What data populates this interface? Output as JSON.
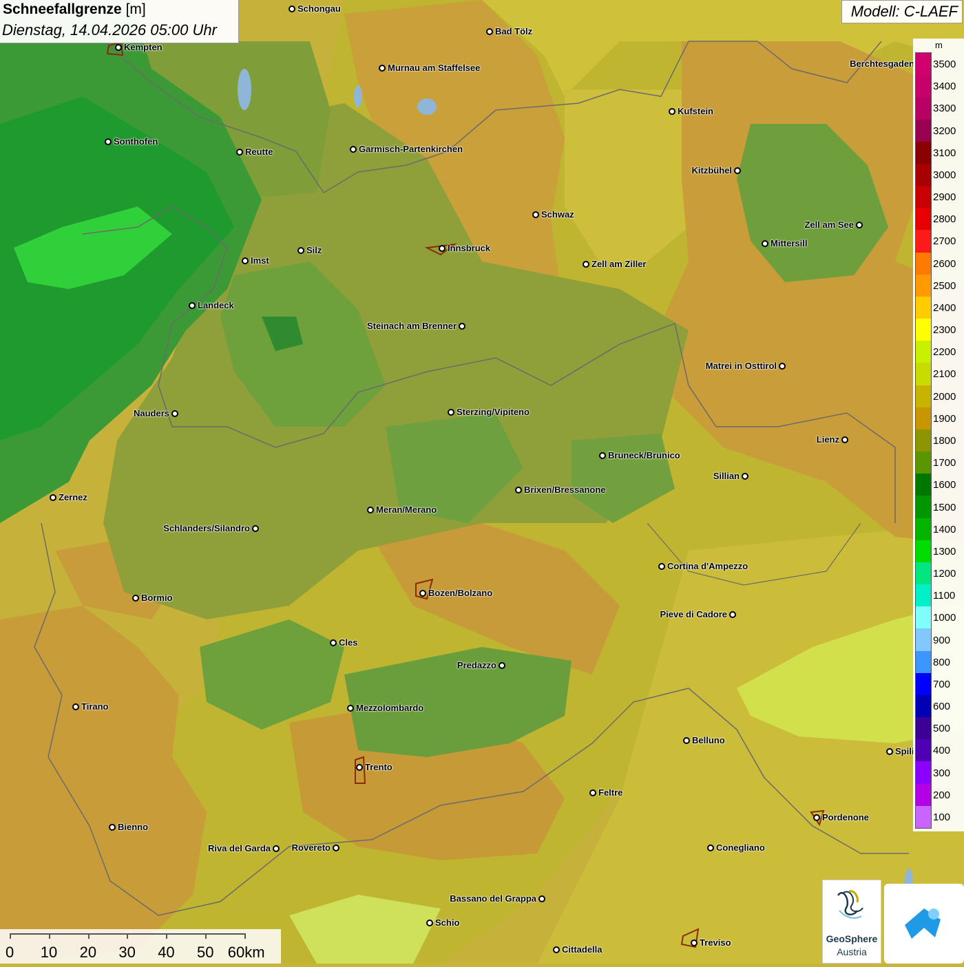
{
  "title": {
    "name": "Schneefallgrenze",
    "unit": "[m]",
    "datetime": "Dienstag, 14.04.2026 05:00 Uhr"
  },
  "model": "Modell: C-LAEF",
  "legend": {
    "unit": "m",
    "levels": [
      {
        "label": "3500",
        "color": "#d0006e"
      },
      {
        "label": "3400",
        "color": "#c8006a"
      },
      {
        "label": "3300",
        "color": "#b80064"
      },
      {
        "label": "3200",
        "color": "#9a0050"
      },
      {
        "label": "3100",
        "color": "#8a0000"
      },
      {
        "label": "3000",
        "color": "#a80000"
      },
      {
        "label": "2900",
        "color": "#c80000"
      },
      {
        "label": "2800",
        "color": "#e80000"
      },
      {
        "label": "2700",
        "color": "#ff1a1a"
      },
      {
        "label": "2600",
        "color": "#ff7a00"
      },
      {
        "label": "2500",
        "color": "#ff9a00"
      },
      {
        "label": "2400",
        "color": "#ffcc00"
      },
      {
        "label": "2300",
        "color": "#ffff00"
      },
      {
        "label": "2200",
        "color": "#c8f000"
      },
      {
        "label": "2100",
        "color": "#c8dc00"
      },
      {
        "label": "2000",
        "color": "#c8b400"
      },
      {
        "label": "1900",
        "color": "#c89600"
      },
      {
        "label": "1800",
        "color": "#8c9600"
      },
      {
        "label": "1700",
        "color": "#5a9600"
      },
      {
        "label": "1600",
        "color": "#007800"
      },
      {
        "label": "1500",
        "color": "#009600"
      },
      {
        "label": "1400",
        "color": "#00b400"
      },
      {
        "label": "1300",
        "color": "#00dc00"
      },
      {
        "label": "1200",
        "color": "#00e680"
      },
      {
        "label": "1100",
        "color": "#00f0c8"
      },
      {
        "label": "1000",
        "color": "#80ffff"
      },
      {
        "label": "900",
        "color": "#80c8ff"
      },
      {
        "label": "800",
        "color": "#3c96ff"
      },
      {
        "label": "700",
        "color": "#0000ff"
      },
      {
        "label": "600",
        "color": "#0000b4"
      },
      {
        "label": "500",
        "color": "#3c0096"
      },
      {
        "label": "400",
        "color": "#5000b4"
      },
      {
        "label": "300",
        "color": "#8c00ff"
      },
      {
        "label": "200",
        "color": "#b400e6"
      },
      {
        "label": "100",
        "color": "#c864ff"
      }
    ]
  },
  "cities": [
    {
      "name": "Schongau",
      "side": "right"
    },
    {
      "name": "Bad Tölz",
      "side": "right"
    },
    {
      "name": "Kempten",
      "side": "right"
    },
    {
      "name": "Murnau am Staffelsee",
      "side": "right"
    },
    {
      "name": "Berchtesgaden",
      "side": "left"
    },
    {
      "name": "Kufstein",
      "side": "right"
    },
    {
      "name": "Sonthofen",
      "side": "right"
    },
    {
      "name": "Reutte",
      "side": "right"
    },
    {
      "name": "Garmisch-Partenkirchen",
      "side": "right"
    },
    {
      "name": "Kitzbühel",
      "side": "left"
    },
    {
      "name": "Schwaz",
      "side": "right"
    },
    {
      "name": "Zell am See",
      "side": "left"
    },
    {
      "name": "Innsbruck",
      "side": "right"
    },
    {
      "name": "Mittersill",
      "side": "right"
    },
    {
      "name": "Silz",
      "side": "right"
    },
    {
      "name": "Imst",
      "side": "right"
    },
    {
      "name": "Zell am Ziller",
      "side": "right"
    },
    {
      "name": "Landeck",
      "side": "right"
    },
    {
      "name": "Steinach am Brenner",
      "side": "left"
    },
    {
      "name": "Matrei in Osttirol",
      "side": "left"
    },
    {
      "name": "Nauders",
      "side": "left"
    },
    {
      "name": "Sterzing/Vipiteno",
      "side": "right"
    },
    {
      "name": "Lienz",
      "side": "left"
    },
    {
      "name": "Bruneck/Brunico",
      "side": "right"
    },
    {
      "name": "Sillian",
      "side": "left"
    },
    {
      "name": "Brixen/Bressanone",
      "side": "right"
    },
    {
      "name": "Zernez",
      "side": "right"
    },
    {
      "name": "Meran/Merano",
      "side": "right"
    },
    {
      "name": "Schlanders/Silandro",
      "side": "left"
    },
    {
      "name": "Cortina d'Ampezzo",
      "side": "right"
    },
    {
      "name": "Bozen/Bolzano",
      "side": "right"
    },
    {
      "name": "Bormio",
      "side": "right"
    },
    {
      "name": "Pieve di Cadore",
      "side": "left"
    },
    {
      "name": "Cles",
      "side": "right"
    },
    {
      "name": "Predazzo",
      "side": "left"
    },
    {
      "name": "Tirano",
      "side": "right"
    },
    {
      "name": "Mezzolombardo",
      "side": "right"
    },
    {
      "name": "Belluno",
      "side": "right"
    },
    {
      "name": "Spili",
      "side": "right"
    },
    {
      "name": "Trento",
      "side": "right"
    },
    {
      "name": "Feltre",
      "side": "right"
    },
    {
      "name": "Pordenone",
      "side": "right"
    },
    {
      "name": "Bienno",
      "side": "right"
    },
    {
      "name": "Riva del Garda",
      "side": "left"
    },
    {
      "name": "Rovereto",
      "side": "left"
    },
    {
      "name": "Conegliano",
      "side": "right"
    },
    {
      "name": "Bassano del Grappa",
      "side": "left"
    },
    {
      "name": "Schio",
      "side": "right"
    },
    {
      "name": "Treviso",
      "side": "right"
    },
    {
      "name": "Cittadella",
      "side": "right"
    }
  ],
  "scale": {
    "labels": [
      "0",
      "10",
      "20",
      "30",
      "40",
      "50",
      "60km"
    ]
  },
  "logo": {
    "name": "GeoSphere",
    "sub": "Austria"
  }
}
